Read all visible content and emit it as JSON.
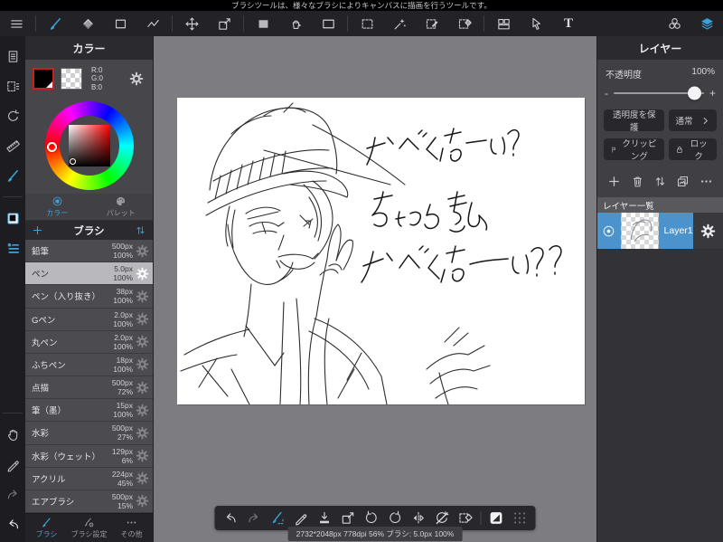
{
  "app": {
    "message": "ブラシツールは、様々なブラシによりキャンバスに描画を行うツールです。"
  },
  "toolbar": {
    "text_tool": "T"
  },
  "color_panel": {
    "title": "カラー",
    "rgb": [
      "R:0",
      "G:0",
      "B:0"
    ],
    "tabs": [
      "カラー",
      "パレット"
    ]
  },
  "brush_panel": {
    "title": "ブラシ",
    "items": [
      {
        "name": "鉛筆",
        "size": "500px",
        "opacity": "100%"
      },
      {
        "name": "ペン",
        "size": "5.0px",
        "opacity": "100%"
      },
      {
        "name": "ペン（入り抜き）",
        "size": "38px",
        "opacity": "100%"
      },
      {
        "name": "Gペン",
        "size": "2.0px",
        "opacity": "100%"
      },
      {
        "name": "丸ペン",
        "size": "2.0px",
        "opacity": "100%"
      },
      {
        "name": "ふちペン",
        "size": "18px",
        "opacity": "100%"
      },
      {
        "name": "点描",
        "size": "500px",
        "opacity": "72%"
      },
      {
        "name": "筆（墨）",
        "size": "15px",
        "opacity": "100%"
      },
      {
        "name": "水彩",
        "size": "500px",
        "opacity": "27%"
      },
      {
        "name": "水彩（ウェット）",
        "size": "129px",
        "opacity": "6%"
      },
      {
        "name": "アクリル",
        "size": "224px",
        "opacity": "45%"
      },
      {
        "name": "エアブラシ",
        "size": "500px",
        "opacity": "15%"
      }
    ],
    "footer_tabs": [
      "ブラシ",
      "ブラシ設定",
      "その他"
    ]
  },
  "layer_panel": {
    "title": "レイヤー",
    "opacity_label": "不透明度",
    "opacity_value": "100%",
    "minus": "-",
    "plus": "+",
    "protect_alpha": "透明度を保護",
    "blend_mode": "通常",
    "clipping": "クリッピング",
    "lock": "ロック",
    "list_header": "レイヤー一覧",
    "layers": [
      {
        "name": "Layer1"
      }
    ]
  },
  "canvas": {
    "handwriting": [
      "かべくなーい?",
      "ちょっときみ",
      "かびくなーい??"
    ],
    "status": "2732*2048px 778dpi 56% ブラシ: 5.0px 100%"
  },
  "colors": {
    "accent": "#3aa2db",
    "selected_layer": "#4b93cc",
    "workspace_bg": "#7c7c81"
  }
}
